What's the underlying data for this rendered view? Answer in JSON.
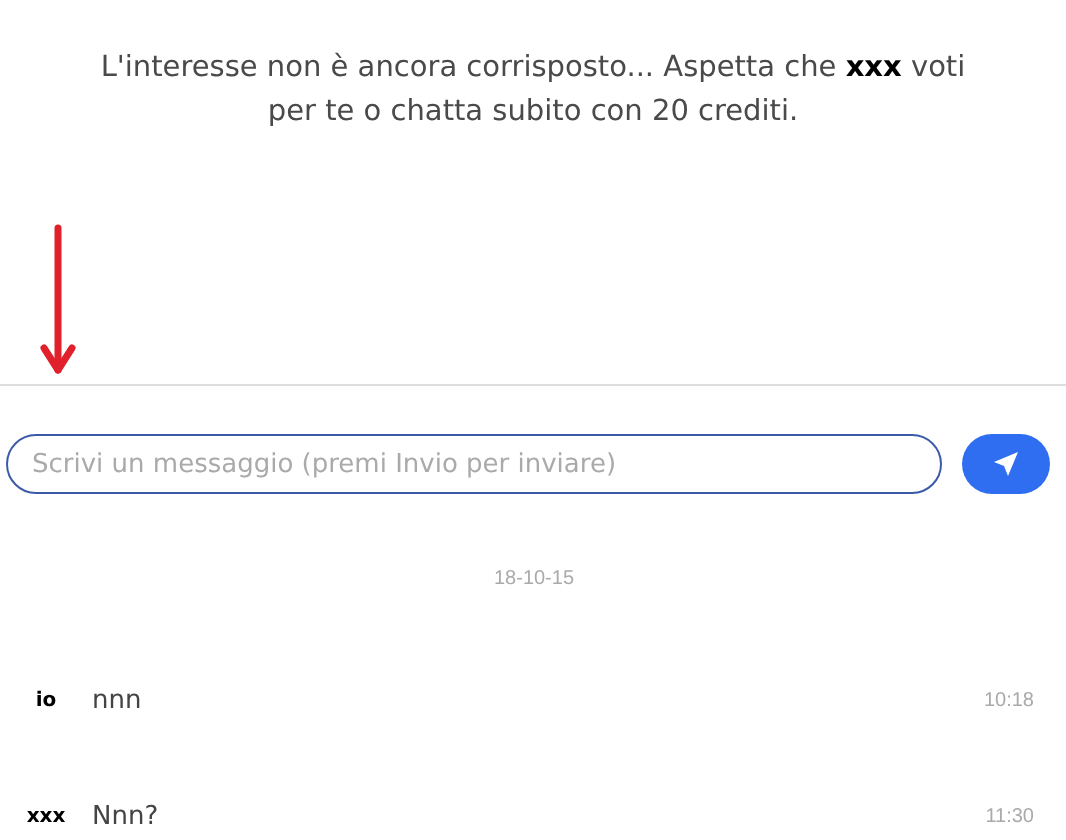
{
  "notice": "L'interesse non è ancora corrisposto... Aspetta che **xxx** voti per te o chatta subito con 20 crediti.",
  "composer": {
    "placeholder": "Scrivi un messaggio (premi Invio per inviare)"
  },
  "date": "18-10-15",
  "messages": [
    {
      "sender": "io",
      "text": "nnn",
      "time": "10:18"
    },
    {
      "sender": "xxx",
      "text": "Nnn?",
      "time": "11:30"
    }
  ]
}
